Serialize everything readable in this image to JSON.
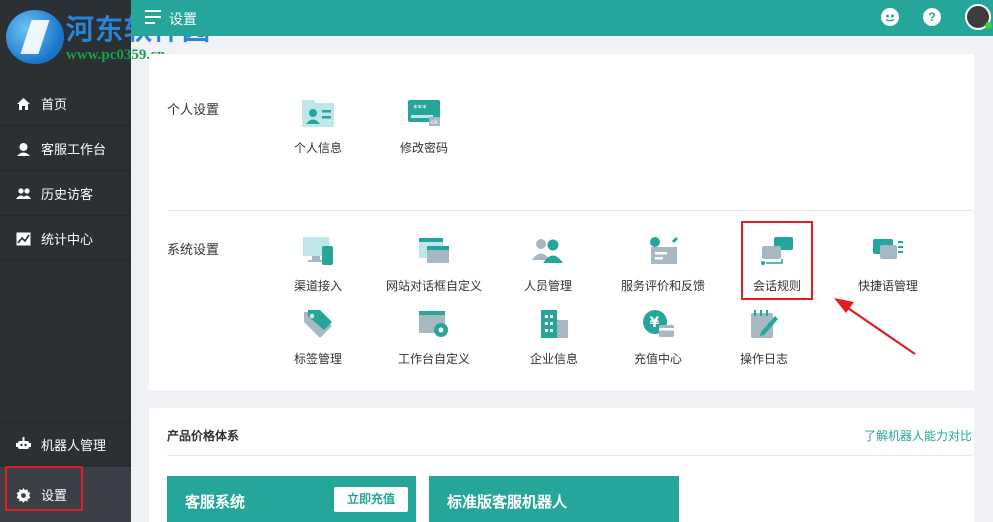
{
  "watermark": {
    "cn": "河东软件园",
    "url": "www.pc0359.cn"
  },
  "header": {
    "title": "设置"
  },
  "sidebar": {
    "items": [
      {
        "label": "首页"
      },
      {
        "label": "客服工作台"
      },
      {
        "label": "历史访客"
      },
      {
        "label": "统计中心"
      },
      {
        "label": "机器人管理"
      },
      {
        "label": "设置"
      }
    ]
  },
  "personal": {
    "label": "个人设置",
    "tiles": [
      {
        "label": "个人信息"
      },
      {
        "label": "修改密码"
      }
    ]
  },
  "system": {
    "label": "系统设置",
    "tiles": [
      {
        "label": "渠道接入"
      },
      {
        "label": "网站对话框自定义"
      },
      {
        "label": "人员管理"
      },
      {
        "label": "服务评价和反馈"
      },
      {
        "label": "会话规则"
      },
      {
        "label": "快捷语管理"
      },
      {
        "label": "标签管理"
      },
      {
        "label": "工作台自定义"
      },
      {
        "label": "企业信息"
      },
      {
        "label": "充值中心"
      },
      {
        "label": "操作日志"
      }
    ]
  },
  "pricing": {
    "title": "产品价格体系",
    "link": "了解机器人能力对比",
    "cards": [
      {
        "name": "客服系统",
        "button": "立即充值"
      },
      {
        "name": "标准版客服机器人"
      }
    ]
  },
  "colors": {
    "accent": "#26a69a",
    "sidebar": "#2b3034",
    "highlight": "#e51c23"
  },
  "icons": {
    "header": [
      "menu-icon",
      "robot-face-icon",
      "help-icon",
      "user-avatar"
    ],
    "sidebar": [
      "home-icon",
      "headset-icon",
      "visitors-icon",
      "chart-icon",
      "robot-icon",
      "gear-icon"
    ]
  }
}
